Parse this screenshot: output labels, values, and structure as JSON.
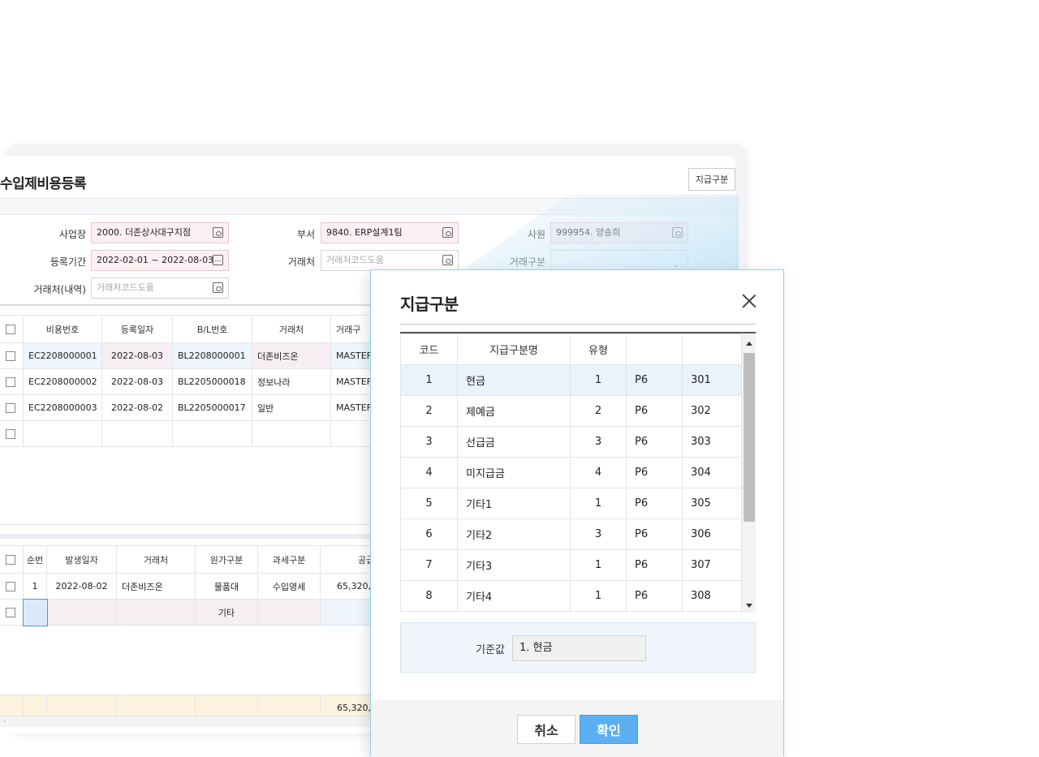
{
  "window": {
    "title": "수입제비용등록",
    "top_button": "지급구분"
  },
  "search": {
    "business_label": "사업장",
    "business_value": "2000. 더존상사대구지점",
    "dept_label": "부서",
    "dept_value": "9840. ERP설계1팀",
    "employee_label": "사원",
    "employee_value": "999954. 양송희",
    "period_label": "등록기간",
    "period_value": "2022-02-01 ~ 2022-08-03",
    "client_label": "거래처",
    "client_placeholder": "거래처코드도움",
    "trade_type_label": "거래구분",
    "trade_type_value": "",
    "client_detail_label": "거래처(내역)",
    "client_detail_placeholder": "거래처코드도움"
  },
  "upper_grid": {
    "headers": [
      "비용번호",
      "등록일자",
      "B/L번호",
      "거래처",
      "거래구"
    ],
    "rows": [
      [
        "EC2208000001",
        "2022-08-03",
        "BL2208000001",
        "더존비즈온",
        "MASTEF"
      ],
      [
        "EC2208000002",
        "2022-08-03",
        "BL2205000018",
        "정보나라",
        "MASTEF"
      ],
      [
        "EC2208000003",
        "2022-08-02",
        "BL2205000017",
        "일반",
        "MASTEF"
      ]
    ]
  },
  "lower_grid": {
    "headers": [
      "순번",
      "발생일자",
      "거래처",
      "원가구분",
      "과세구분",
      "공급"
    ],
    "rows": [
      [
        "1",
        "2022-08-02",
        "더존비즈온",
        "물품대",
        "수입영세",
        "65,320,"
      ],
      [
        "",
        "",
        "",
        "기타",
        "",
        ""
      ]
    ],
    "total": "65,320,"
  },
  "dialog": {
    "title": "지급구분",
    "headers": [
      "코드",
      "지급구분명",
      "유형",
      "",
      ""
    ],
    "rows": [
      [
        "1",
        "현금",
        "1",
        "P6",
        "301"
      ],
      [
        "2",
        "제예금",
        "2",
        "P6",
        "302"
      ],
      [
        "3",
        "선급금",
        "3",
        "P6",
        "303"
      ],
      [
        "4",
        "미지급금",
        "4",
        "P6",
        "304"
      ],
      [
        "5",
        "기타1",
        "1",
        "P6",
        "305"
      ],
      [
        "6",
        "기타2",
        "3",
        "P6",
        "306"
      ],
      [
        "7",
        "기타3",
        "1",
        "P6",
        "307"
      ],
      [
        "8",
        "기타4",
        "1",
        "P6",
        "308"
      ]
    ],
    "standard_label": "기준값",
    "standard_value": "1. 현금",
    "cancel_label": "취소",
    "ok_label": "확인"
  },
  "colors": {
    "accent": "#5aaef2",
    "required_field": "#fdf0f3",
    "selected_row": "#eaf3fc"
  }
}
